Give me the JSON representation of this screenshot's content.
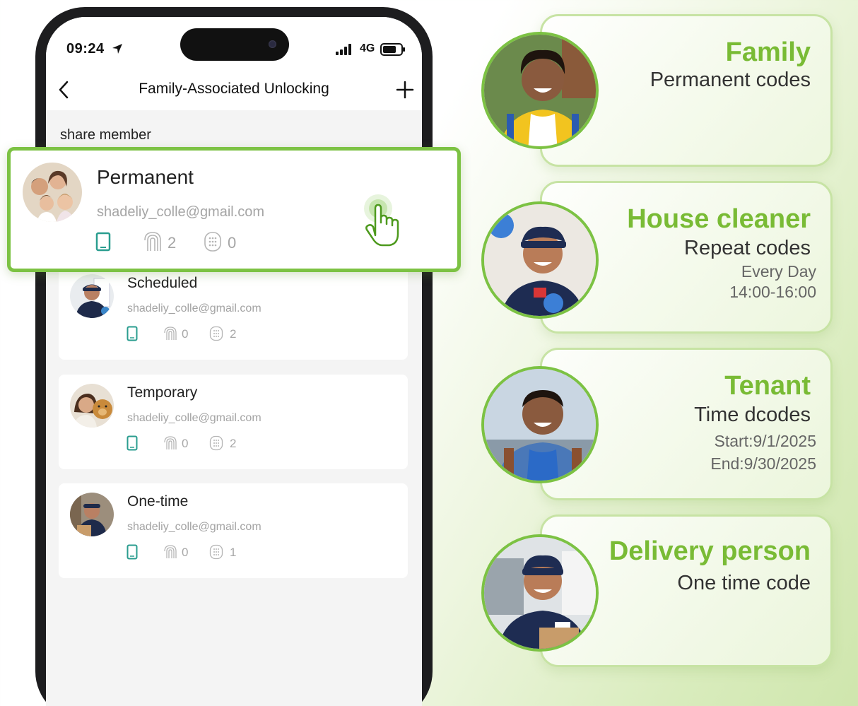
{
  "status_bar": {
    "time": "09:24",
    "network": "4G"
  },
  "nav": {
    "title": "Family-Associated Unlocking"
  },
  "section_label": "share member",
  "highlighted_member": {
    "title": "Permanent",
    "email": "shadeliy_colle@gmail.com",
    "fingerprint_count": "2",
    "keypad_count": "0"
  },
  "members": [
    {
      "title": "Scheduled",
      "email": "shadeliy_colle@gmail.com",
      "fingerprint_count": "0",
      "keypad_count": "2"
    },
    {
      "title": "Temporary",
      "email": "shadeliy_colle@gmail.com",
      "fingerprint_count": "0",
      "keypad_count": "2"
    },
    {
      "title": "One-time",
      "email": "shadeliy_colle@gmail.com",
      "fingerprint_count": "0",
      "keypad_count": "1"
    }
  ],
  "personas": [
    {
      "title": "Family",
      "subtitle": "Permanent codes",
      "details": []
    },
    {
      "title": "House cleaner",
      "subtitle": "Repeat codes",
      "details": [
        "Every Day",
        "14:00-16:00"
      ]
    },
    {
      "title": "Tenant",
      "subtitle": "Time dcodes",
      "details": [
        "Start:9/1/2025",
        "End:9/30/2025"
      ]
    },
    {
      "title": "Delivery person",
      "subtitle": "One time code",
      "details": []
    }
  ],
  "colors": {
    "accent_green": "#7cc243",
    "title_green": "#79bb35",
    "icon_teal": "#2a9d8f"
  }
}
